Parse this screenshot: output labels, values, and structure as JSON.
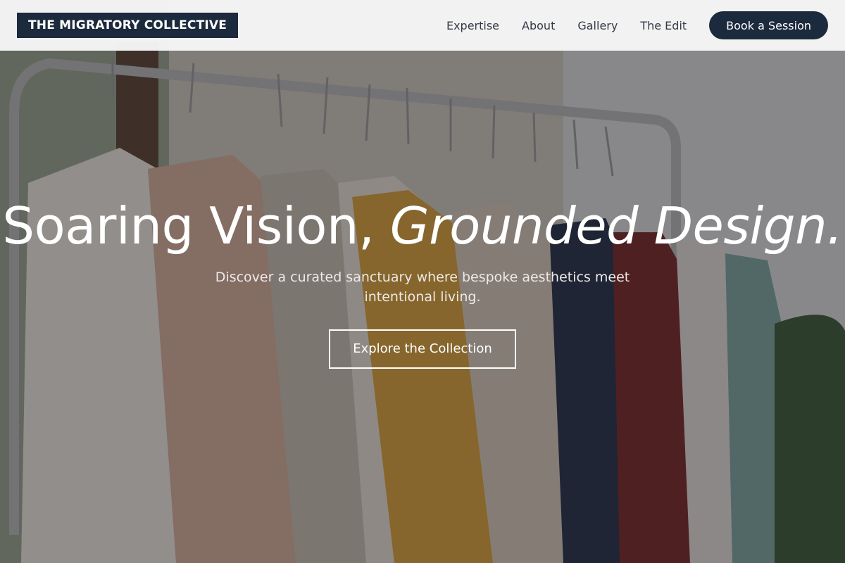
{
  "brand": {
    "name": "THE MIGRATORY COLLECTIVE"
  },
  "nav": {
    "links": [
      "Expertise",
      "About",
      "Gallery",
      "The Edit"
    ],
    "cta_label": "Book a Session"
  },
  "hero": {
    "headline_regular": "Soaring Vision, ",
    "headline_italic": "Grounded Design.",
    "subtitle": "Discover a curated sanctuary where bespoke aesthetics meet intentional living.",
    "button_label": "Explore the Collection",
    "image_description_icon": "clothing-rack-photo"
  },
  "colors": {
    "brand_navy": "#1c2a3d",
    "nav_background": "#f7f7f8",
    "hero_text": "#ffffff"
  }
}
